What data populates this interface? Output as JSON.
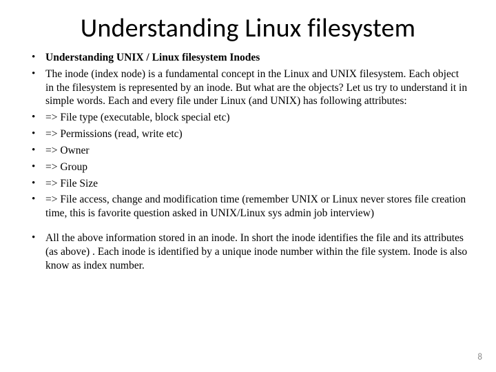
{
  "title": "Understanding Linux filesystem",
  "bullets": [
    {
      "text": "Understanding UNIX / Linux filesystem Inodes",
      "bold": true
    },
    {
      "text": "The inode (index node) is a fundamental concept in the Linux and UNIX filesystem. Each object in the filesystem is represented by an inode. But what are the objects? Let us try to understand it in simple words. Each and every file under Linux (and UNIX) has following attributes:"
    },
    {
      "text": "=> File type (executable, block special etc)"
    },
    {
      "text": "=> Permissions (read, write etc)"
    },
    {
      "text": "=> Owner"
    },
    {
      "text": "=> Group"
    },
    {
      "text": "=> File Size"
    },
    {
      "text": "=> File access, change and modification time (remember UNIX or Linux never stores file creation time, this is favorite question asked in UNIX/Linux sys admin job interview)"
    },
    {
      "text": "All the above information stored in an inode. In short the inode identifies the file and its attributes (as above) . Each inode is identified by a unique inode number within the file system. Inode is also know as index number.",
      "spaced": true
    }
  ],
  "page_number": "8"
}
